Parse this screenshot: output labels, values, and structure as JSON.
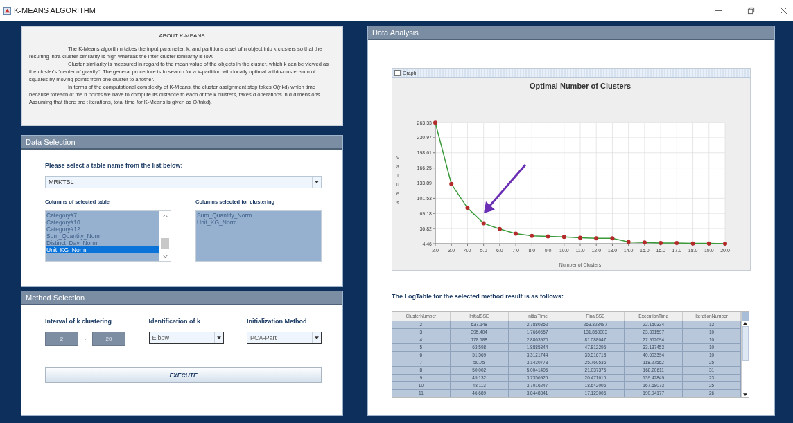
{
  "window": {
    "title": "K-MEANS ALGORITHM"
  },
  "about": {
    "title": "ABOUT K-MEANS",
    "paragraphs": [
      "The K-Means algorithm takes the input parameter, k, and partitions a set of n object into k clusters so that the resulting intra-cluster similarity is high whereas the inter-cluster similarity is low.",
      "Cluster similarity is measured in regard to the mean value of the objects in the cluster, which k can be viewed as the cluster's \"center of gravity\". The general procedure is to search for a k-partition with locally optimal within-cluster sum of squares by moving points from one cluster to another.",
      "In terms of the computational complexity of K-Means, the cluster assignment step takes O(nkd) which time because foreach of the n points we have to compute its distance to each of the k clusters, takes d operations in d dimensions. Assuming that there are t iterations, total time for K-Means is given as O(tnkd)."
    ]
  },
  "data_selection": {
    "header": "Data Selection",
    "prompt": "Please select a table name from the list below:",
    "table_select": "MRKTBL",
    "columns_label": "Columns of selected table",
    "selected_label": "Columns selected for clustering",
    "columns": [
      {
        "name": "Category#7",
        "selected": false
      },
      {
        "name": "Category#10",
        "selected": false
      },
      {
        "name": "Category#12",
        "selected": false
      },
      {
        "name": "Sum_Quantity_Norm",
        "selected": false
      },
      {
        "name": "Distinct_Day_Norm",
        "selected": false
      },
      {
        "name": "Unit_KG_Norm",
        "selected": true
      }
    ],
    "selected_columns": [
      "Sum_Quantity_Norm",
      "Unit_KG_Norm"
    ]
  },
  "method_selection": {
    "header": "Method Selection",
    "interval_label": "Interval of k clustering",
    "k_min": "2",
    "separator": "-",
    "k_max": "20",
    "identification_label": "Identification of k",
    "identification": "Elbow",
    "init_label": "Initialization Method",
    "init": "PCA-Part",
    "execute": "EXECUTE"
  },
  "data_analysis": {
    "header": "Data Analysis",
    "graph_checkbox": {
      "label": "Graph",
      "checked": false
    },
    "chart_data": {
      "type": "line",
      "title": "Optimal Number of Clusters",
      "xlabel": "Number of Clusters",
      "ylabel": "Values",
      "x": [
        2,
        3,
        4,
        5,
        6,
        7,
        8,
        9,
        10,
        11,
        12,
        13,
        14,
        15,
        16,
        17,
        18,
        19,
        20
      ],
      "series": [
        {
          "color": "#3a9a3a",
          "marker": "circle",
          "values": [
            263,
            132,
            81,
            48,
            36,
            26,
            21,
            20,
            19,
            17,
            16,
            16,
            8,
            7,
            6,
            6,
            5,
            5,
            4.5
          ]
        }
      ],
      "grid": true,
      "xlim": [
        2,
        20
      ],
      "ylim": [
        4.46,
        263.33
      ],
      "xticks": [
        {
          "value": 2,
          "label": "2.0"
        },
        {
          "value": 3,
          "label": "3.0"
        },
        {
          "value": 4,
          "label": "4.0"
        },
        {
          "value": 5,
          "label": "5.0"
        },
        {
          "value": 6,
          "label": "6.0"
        },
        {
          "value": 7,
          "label": "7.0"
        },
        {
          "value": 8,
          "label": "8.0"
        },
        {
          "value": 9,
          "label": "9.0"
        },
        {
          "value": 10,
          "label": "10.0"
        },
        {
          "value": 11,
          "label": "11.0"
        },
        {
          "value": 12,
          "label": "12.0"
        },
        {
          "value": 13,
          "label": "13.0"
        },
        {
          "value": 14,
          "label": "14.0"
        },
        {
          "value": 15,
          "label": "15.0"
        },
        {
          "value": 16,
          "label": "16.0"
        },
        {
          "value": 17,
          "label": "17.0"
        },
        {
          "value": 18,
          "label": "18.0"
        },
        {
          "value": 19,
          "label": "19.0"
        },
        {
          "value": 20,
          "label": "20.0"
        }
      ],
      "yticks": [
        4.46,
        36.82,
        69.18,
        101.53,
        133.89,
        166.25,
        198.61,
        230.97,
        {
          "value": 263.33,
          "label": "263.33"
        }
      ]
    },
    "log_title": "The LogTable for the selected method result is as follows:",
    "log_table": {
      "columns": [
        "ClusterNumber",
        "InitialSSE",
        "InitialTime",
        "FinalSSE",
        "ExecutionTime",
        "IterationNumber"
      ],
      "rows": [
        [
          "2",
          "637.148",
          "2.7880852",
          "263.328487",
          "22.150334",
          "13"
        ],
        [
          "3",
          "395.404",
          "1.7660657",
          "131.858003",
          "23.301597",
          "10"
        ],
        [
          "4",
          "178.188",
          "2.8863970",
          "81.088047",
          "27.952694",
          "10"
        ],
        [
          "5",
          "63.598",
          "1.8885344",
          "47.812295",
          "33.137453",
          "10"
        ],
        [
          "6",
          "51.569",
          "3.3121744",
          "35.516718",
          "40.603394",
          "10"
        ],
        [
          "7",
          "50.75",
          "3.1430773",
          "25.760536",
          "118.27562",
          "25"
        ],
        [
          "8",
          "50.002",
          "5.0041405",
          "21.037375",
          "168.20611",
          "31"
        ],
        [
          "9",
          "49.132",
          "3.7356925",
          "20.471616",
          "139.42849",
          "23"
        ],
        [
          "10",
          "48.113",
          "3.7016247",
          "18.642006",
          "167.68073",
          "25"
        ],
        [
          "11",
          "46.689",
          "3.8448341",
          "17.123006",
          "190.94177",
          "26"
        ]
      ]
    }
  }
}
